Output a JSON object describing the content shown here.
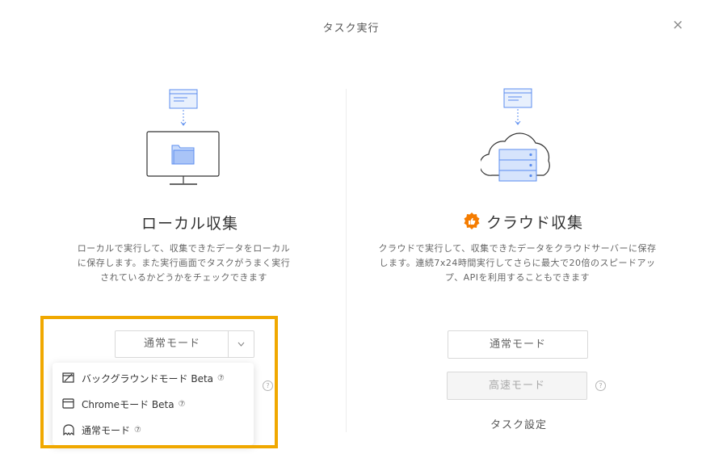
{
  "dialog": {
    "title": "タスク実行",
    "close_symbol": "×"
  },
  "local": {
    "title": "ローカル収集",
    "description_lines": [
      "ローカルで実行して、収集できたデータをローカル",
      "に保存します。また実行画面でタスクがうまく実行",
      "されているかどうかをチェックできます"
    ],
    "mode_select": {
      "value": "通常モード",
      "chevron": "∨"
    },
    "dropdown_items": [
      {
        "label": "バックグラウンドモード Beta",
        "icon": "background-mode-icon"
      },
      {
        "label": "Chromeモード Beta",
        "icon": "browser-window-icon"
      },
      {
        "label": "通常モード",
        "icon": "ghost-icon"
      }
    ],
    "help_symbol": "?"
  },
  "cloud": {
    "title": "クラウド収集",
    "badge_icon": "thumbs-up-icon",
    "description_lines": [
      "クラウドで実行して、収集できたデータをクラウドサーバーに保存",
      "します。連続7x24時間実行してさらに最大で20倍のスピードアッ",
      "プ、APIを利用することもできます"
    ],
    "normal_mode_label": "通常モード",
    "fast_mode_label": "高速モード",
    "task_settings_label": "タスク設定",
    "help_symbol": "?"
  },
  "colors": {
    "highlight": "#f0a800",
    "badge": "#f57c00",
    "illustration_blue": "#5b8def"
  }
}
